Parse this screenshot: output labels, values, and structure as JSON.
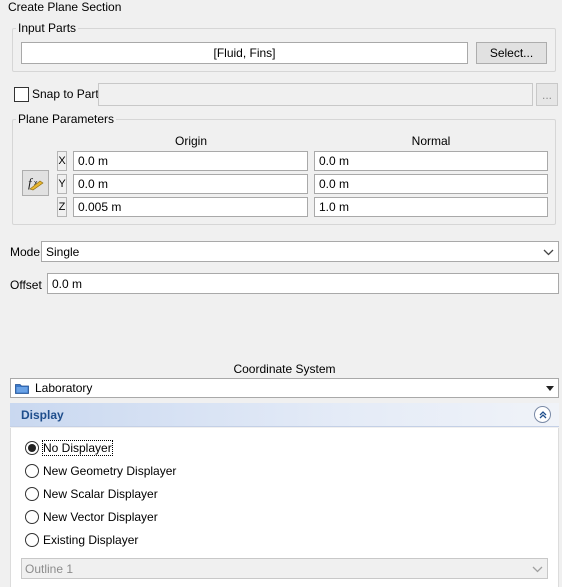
{
  "title": "Create Plane Section",
  "input_parts": {
    "group_label": "Input Parts",
    "value": "[Fluid, Fins]",
    "select_button": "Select..."
  },
  "snap": {
    "label": "Snap to Part",
    "checked": false,
    "browse_button": "..."
  },
  "plane": {
    "group_label": "Plane Parameters",
    "origin_header": "Origin",
    "normal_header": "Normal",
    "axes": [
      "X",
      "Y",
      "Z"
    ],
    "origin": [
      "0.0 m",
      "0.0 m",
      "0.005 m"
    ],
    "normal": [
      "0.0 m",
      "0.0 m",
      "1.0 m"
    ],
    "function_icon": "function-icon"
  },
  "mode": {
    "label": "Mode",
    "value": "Single"
  },
  "offset": {
    "label": "Offset",
    "value": "0.0 m"
  },
  "coordinate_system": {
    "label": "Coordinate System",
    "value": "Laboratory"
  },
  "display": {
    "section_title": "Display",
    "options": [
      "No Displayer",
      "New Geometry Displayer",
      "New Scalar Displayer",
      "New Vector Displayer",
      "Existing Displayer"
    ],
    "selected_index": 0,
    "existing_value": "Outline 1"
  },
  "colors": {
    "section_header_start": "#c9d8f0",
    "section_header_end": "#f0f3f8",
    "section_title_text": "#1f4e8c"
  }
}
